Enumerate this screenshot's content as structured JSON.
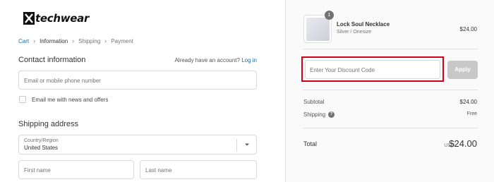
{
  "brand": {
    "name": "techwear"
  },
  "breadcrumb": {
    "items": [
      {
        "label": "Cart",
        "state": "link"
      },
      {
        "label": "Information",
        "state": "current"
      },
      {
        "label": "Shipping",
        "state": "upcoming"
      },
      {
        "label": "Payment",
        "state": "upcoming"
      }
    ]
  },
  "contact": {
    "title": "Contact information",
    "have_account": "Already have an account?",
    "login_label": "Log in",
    "email_placeholder": "Email or mobile phone number",
    "newsletter_label": "Email me with news and offers"
  },
  "shipping": {
    "title": "Shipping address",
    "country_label": "Country/Region",
    "country_value": "United States",
    "first_name_placeholder": "First name",
    "last_name_placeholder": "Last name"
  },
  "summary": {
    "product": {
      "quantity": "1",
      "name": "Lock Soul Necklace",
      "variant": "Silver / Onesize",
      "price": "$24.00"
    },
    "discount_placeholder": "Enter Your Discount Code",
    "apply_label": "Apply",
    "subtotal_label": "Subtotal",
    "subtotal_value": "$24.00",
    "shipping_label": "Shipping",
    "shipping_value": "Free",
    "total_label": "Total",
    "total_currency": "USD",
    "total_value": "$24.00"
  },
  "colors": {
    "link": "#1a6e9e",
    "highlight": "#d0021b",
    "apply_button": "#c8c8c8"
  },
  "icons": [
    "chevron-right-icon",
    "chevron-down-icon",
    "help-icon",
    "brand-x-icon"
  ]
}
